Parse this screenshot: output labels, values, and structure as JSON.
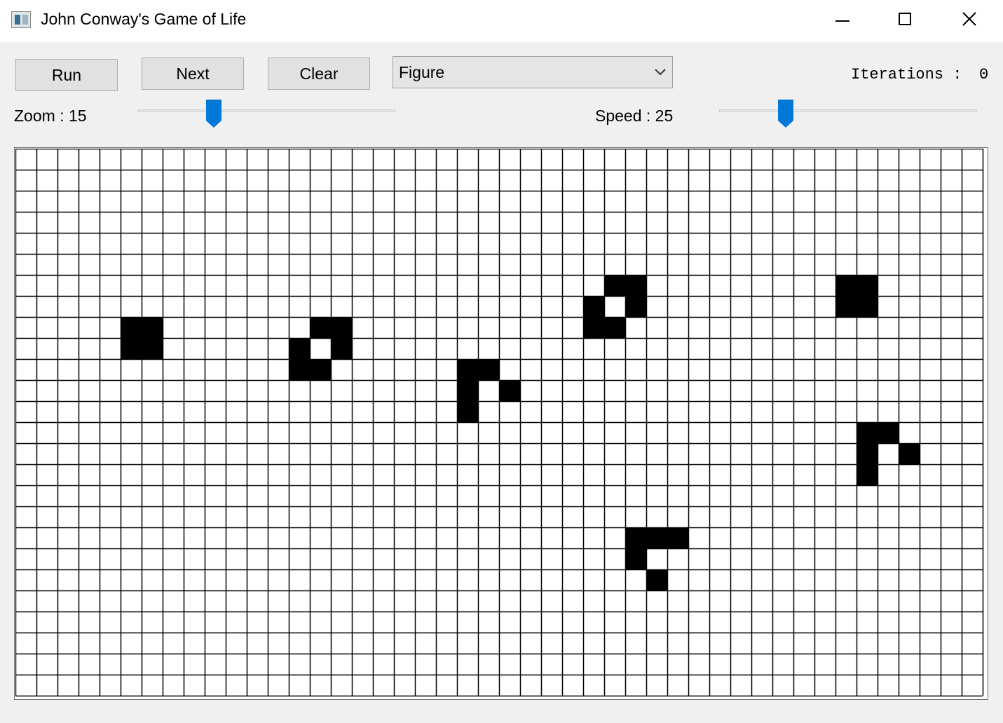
{
  "window": {
    "title": "John Conway's Game of Life"
  },
  "toolbar": {
    "run_label": "Run",
    "next_label": "Next",
    "clear_label": "Clear",
    "figure_selected": "Figure",
    "iterations_label": "Iterations :",
    "iterations_value": "0"
  },
  "controls": {
    "zoom_label": "Zoom : 15",
    "zoom_value": 15,
    "speed_label": "Speed : 25",
    "speed_value": 25
  },
  "board": {
    "columns": 46,
    "rows": 26,
    "live_cells": [
      [
        5,
        8
      ],
      [
        6,
        8
      ],
      [
        5,
        9
      ],
      [
        6,
        9
      ],
      [
        14,
        8
      ],
      [
        15,
        8
      ],
      [
        13,
        9
      ],
      [
        15,
        9
      ],
      [
        13,
        10
      ],
      [
        14,
        10
      ],
      [
        21,
        10
      ],
      [
        22,
        10
      ],
      [
        21,
        11
      ],
      [
        23,
        11
      ],
      [
        21,
        12
      ],
      [
        28,
        6
      ],
      [
        29,
        6
      ],
      [
        27,
        7
      ],
      [
        29,
        7
      ],
      [
        27,
        8
      ],
      [
        28,
        8
      ],
      [
        39,
        6
      ],
      [
        40,
        6
      ],
      [
        39,
        7
      ],
      [
        40,
        7
      ],
      [
        40,
        13
      ],
      [
        41,
        13
      ],
      [
        40,
        14
      ],
      [
        42,
        14
      ],
      [
        40,
        15
      ],
      [
        29,
        18
      ],
      [
        30,
        18
      ],
      [
        31,
        18
      ],
      [
        29,
        19
      ],
      [
        30,
        20
      ]
    ],
    "colors": {
      "live": "#000000",
      "dead": "#ffffff",
      "grid": "#000000"
    }
  },
  "accent_color": "#0078d7"
}
